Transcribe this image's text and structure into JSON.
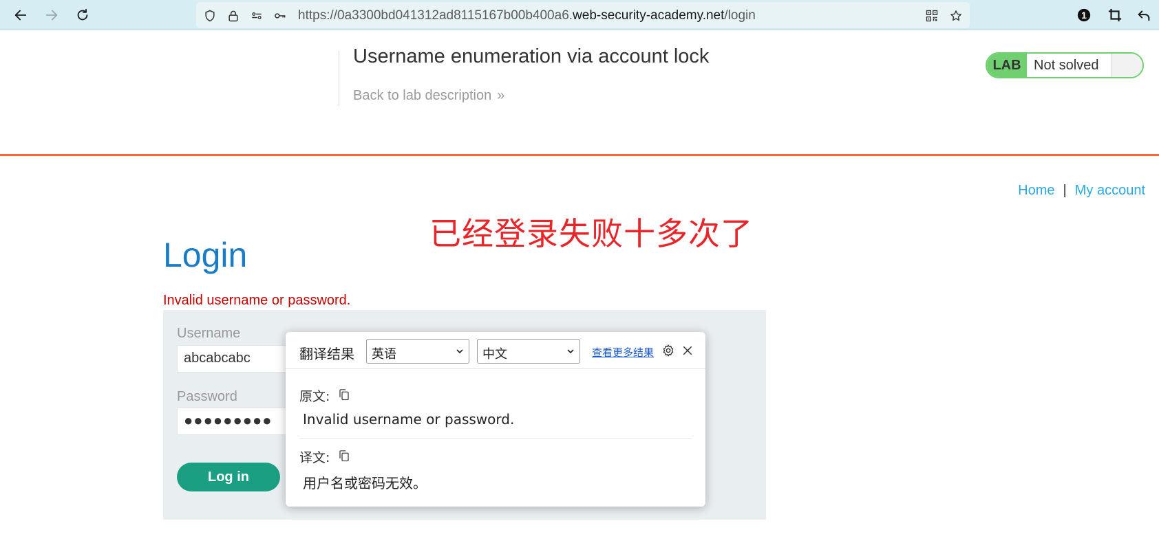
{
  "browser": {
    "url_prefix": "https://0a3300bd041312ad8115167b00b400a6.",
    "url_domain": "web-security-academy.net",
    "url_path": "/login",
    "badge_count": "1"
  },
  "lab": {
    "title": "Username enumeration via account lock",
    "back_link": "Back to lab description",
    "tag": "LAB",
    "status": "Not solved",
    "accent_color": "#70d070",
    "rule_color": "#ff6633"
  },
  "nav": {
    "home": "Home",
    "separator": "|",
    "my_account": "My account"
  },
  "annotation": "已经登录失败十多次了",
  "login": {
    "heading": "Login",
    "error": "Invalid username or password.",
    "username_label": "Username",
    "username_value": "abcabcabc",
    "password_label": "Password",
    "password_value": "●●●●●●●●●",
    "button": "Log in"
  },
  "translate_popup": {
    "title": "翻译结果",
    "source_lang": "英语",
    "target_lang": "中文",
    "more_results": "查看更多结果",
    "original_label": "原文:",
    "original_text": "Invalid username or password.",
    "translation_label": "译文:",
    "translation_text": "用户名或密码无效。"
  }
}
